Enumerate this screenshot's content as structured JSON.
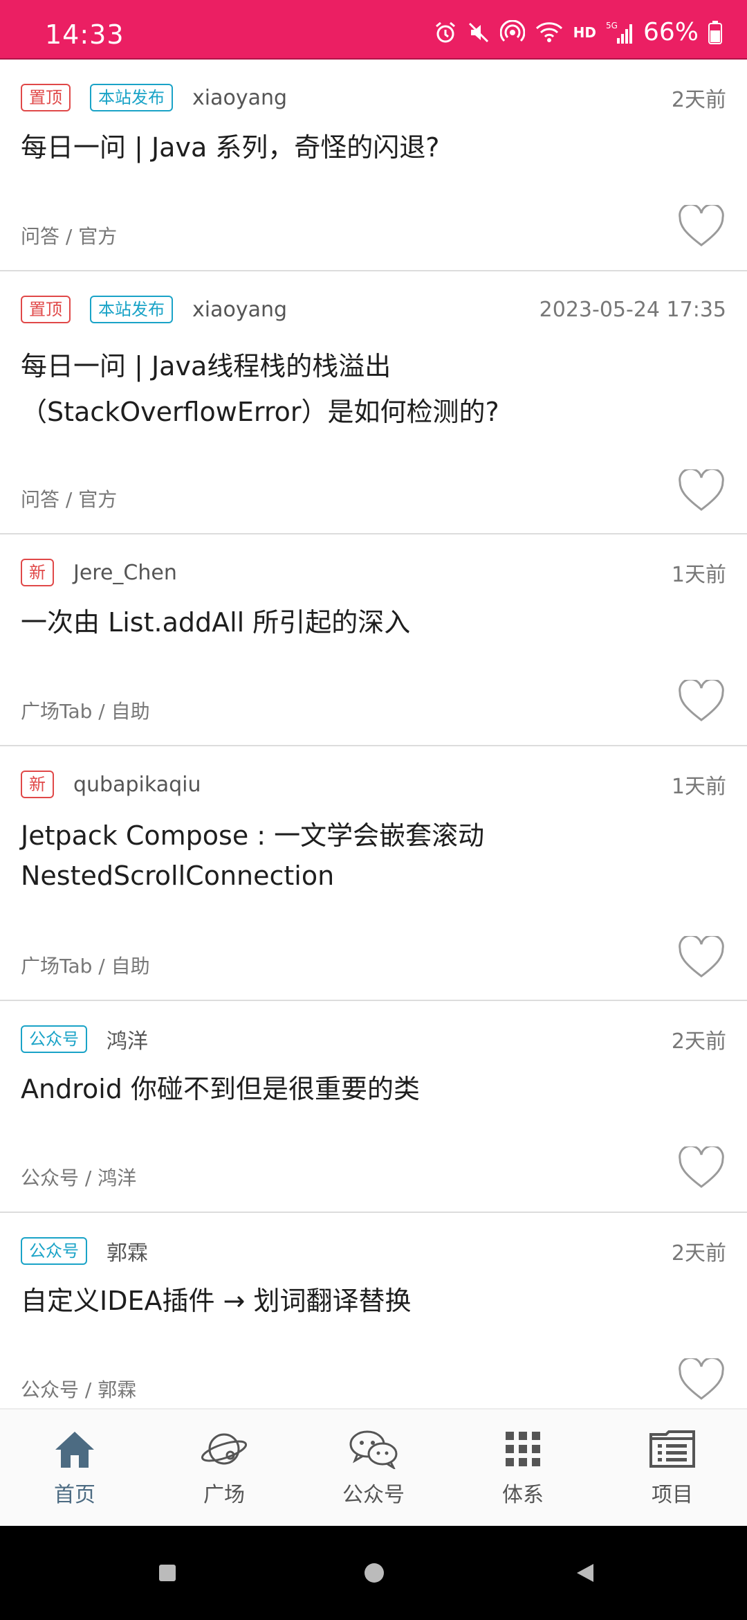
{
  "status_bar": {
    "time": "14:33",
    "battery": "66%",
    "network": "HD",
    "signal_label": "5G"
  },
  "articles": [
    {
      "tags": [
        {
          "text": "置顶",
          "color": "red"
        },
        {
          "text": "本站发布",
          "color": "teal"
        }
      ],
      "author": "xiaoyang",
      "time": "2天前",
      "title": "每日一问 | Java 系列，奇怪的闪退?",
      "category": "问答 / 官方"
    },
    {
      "tags": [
        {
          "text": "置顶",
          "color": "red"
        },
        {
          "text": "本站发布",
          "color": "teal"
        }
      ],
      "author": "xiaoyang",
      "time": "2023-05-24 17:35",
      "title": "每日一问 | Java线程栈的栈溢出（StackOverflowError）是如何检测的?",
      "category": "问答 / 官方"
    },
    {
      "tags": [
        {
          "text": "新",
          "color": "red"
        }
      ],
      "author": "Jere_Chen",
      "time": "1天前",
      "title": "一次由 List.addAll 所引起的深入",
      "category": "广场Tab / 自助"
    },
    {
      "tags": [
        {
          "text": "新",
          "color": "red"
        }
      ],
      "author": "qubapikaqiu",
      "time": "1天前",
      "title": "Jetpack Compose : 一文学会嵌套滚动NestedScrollConnection",
      "category": "广场Tab / 自助"
    },
    {
      "tags": [
        {
          "text": "公众号",
          "color": "teal"
        }
      ],
      "author": "鸿洋",
      "time": "2天前",
      "title": "Android 你碰不到但是很重要的类",
      "category": "公众号 / 鸿洋"
    },
    {
      "tags": [
        {
          "text": "公众号",
          "color": "teal"
        }
      ],
      "author": "郭霖",
      "time": "2天前",
      "title": "自定义IDEA插件 → 划词翻译替换",
      "category": "公众号 / 郭霖"
    }
  ],
  "bottom_nav": [
    {
      "label": "首页",
      "icon": "home-icon",
      "active": true
    },
    {
      "label": "广场",
      "icon": "planet-icon",
      "active": false
    },
    {
      "label": "公众号",
      "icon": "wechat-icon",
      "active": false
    },
    {
      "label": "体系",
      "icon": "grid-icon",
      "active": false
    },
    {
      "label": "项目",
      "icon": "folder-list-icon",
      "active": false
    }
  ],
  "colors": {
    "status_bar": "#EB1F63",
    "tag_red": "#e04848",
    "tag_teal": "#1aa3c7",
    "nav_active": "#4c6b82"
  }
}
